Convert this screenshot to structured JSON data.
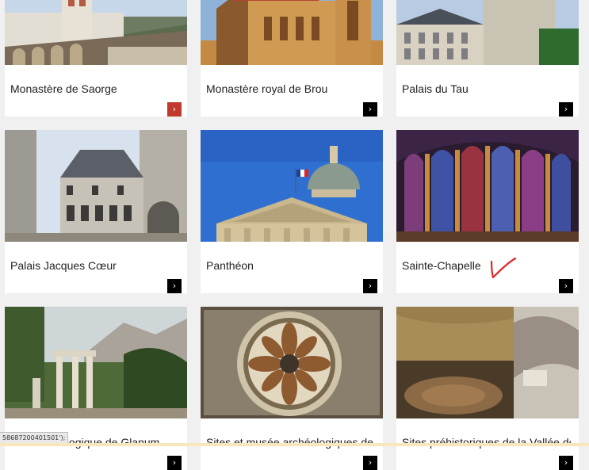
{
  "cards": [
    {
      "title": "Monastère de Saorge",
      "arrow": "›",
      "active": true
    },
    {
      "title": "Monastère royal de Brou",
      "arrow": "›",
      "active": false
    },
    {
      "title": "Palais du Tau",
      "arrow": "›",
      "active": false
    },
    {
      "title": "Palais Jacques Cœur",
      "arrow": "›",
      "active": false
    },
    {
      "title": "Panthéon",
      "arrow": "›",
      "active": false
    },
    {
      "title": "Sainte-Chapelle",
      "arrow": "›",
      "active": false
    },
    {
      "title": "Site archéologique de Glanum",
      "arrow": "›",
      "active": false
    },
    {
      "title": "Sites et musée archéologiques de",
      "arrow": "›",
      "active": false
    },
    {
      "title": "Sites préhistoriques de la Vallée de",
      "arrow": "›",
      "active": false
    }
  ],
  "status_bar": {
    "text": "58687200401501');"
  },
  "annotation": {
    "icon": "handwritten-checkmark-icon",
    "color": "#e0262b"
  },
  "colors": {
    "background": "#f0f0f0",
    "button": "#000000",
    "button_active": "#c0392b"
  }
}
